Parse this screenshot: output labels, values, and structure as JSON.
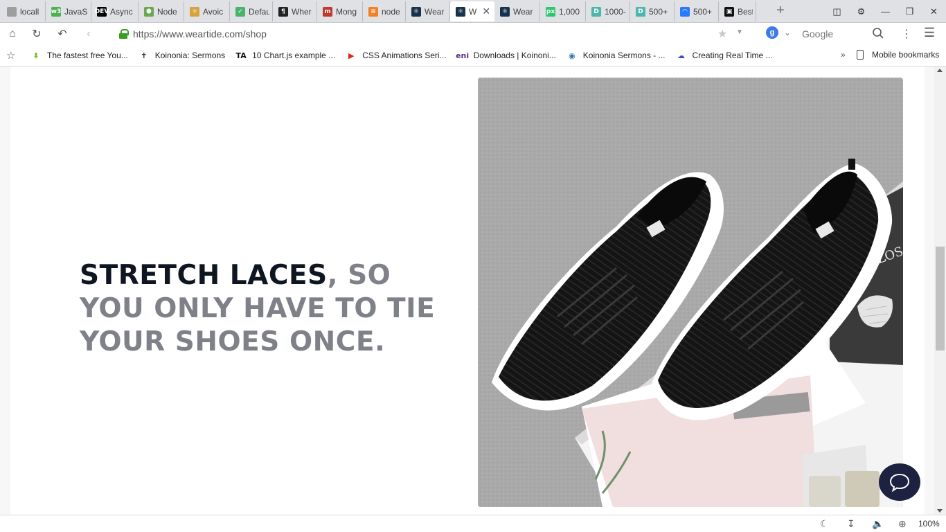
{
  "browser": {
    "tabs": [
      {
        "title": "locall",
        "icon": "page-icon",
        "color": "#9e9e9e"
      },
      {
        "title": "JavaS",
        "icon": "w3schools-icon",
        "color": "#4caf50"
      },
      {
        "title": "Async",
        "icon": "dev-icon",
        "color": "#000000"
      },
      {
        "title": "Node",
        "icon": "nodejs-icon",
        "color": "#6aa84f"
      },
      {
        "title": "Avoic",
        "icon": "sun-icon",
        "color": "#d7a23a"
      },
      {
        "title": "Defau",
        "icon": "shield-icon",
        "color": "#49b36b"
      },
      {
        "title": "Wher",
        "icon": "pilcrow-icon",
        "color": "#222222"
      },
      {
        "title": "Mong",
        "icon": "medium-icon",
        "color": "#c0392b"
      },
      {
        "title": "node",
        "icon": "stackoverflow-icon",
        "color": "#f48024"
      },
      {
        "title": "Wear",
        "icon": "react-icon",
        "color": "#17324d"
      },
      {
        "title": "W",
        "icon": "react-icon",
        "color": "#17324d",
        "active": true
      },
      {
        "title": "Wear",
        "icon": "react-icon",
        "color": "#17324d"
      },
      {
        "title": "1,000",
        "icon": "pixabay-icon",
        "color": "#2ec66d"
      },
      {
        "title": "1000-",
        "icon": "d-icon",
        "color": "#4db6ac"
      },
      {
        "title": "500+",
        "icon": "d-icon",
        "color": "#4db6ac"
      },
      {
        "title": "500+",
        "icon": "loading-icon",
        "color": "#2979ff"
      },
      {
        "title": "Best",
        "icon": "unsplash-icon",
        "color": "#111111"
      }
    ],
    "url": "https://www.weartide.com/shop",
    "search_engine_letter": "g",
    "search_placeholder": "Google",
    "zoom": "100%"
  },
  "bookmarks": {
    "items": [
      {
        "label": "The fastest free You...",
        "icon": "download-arrow-icon",
        "color": "#6cbf2a"
      },
      {
        "label": "Koinonia: Sermons",
        "icon": "cross-icon",
        "color": "#3b2a14"
      },
      {
        "label": "10 Chart.js example ...",
        "icon": "ta-icon",
        "color": "#111111"
      },
      {
        "label": "CSS Animations Seri...",
        "icon": "youtube-icon",
        "color": "#e62117"
      },
      {
        "label": "Downloads | Koinoni...",
        "icon": "eni-icon",
        "color": "#5b2c83"
      },
      {
        "label": "Koinonia Sermons - ...",
        "icon": "globe-icon",
        "color": "#2a6fb0"
      },
      {
        "label": "Creating Real Time ...",
        "icon": "cloud-icon",
        "color": "#3a4fc4"
      }
    ],
    "overflow_label": "»",
    "mobile_label": "Mobile bookmarks"
  },
  "page": {
    "headline_highlight": "STRETCH LACES",
    "headline_rest": ", SO YOU ONLY HAVE TO TIE YOUR SHOES ONCE.",
    "headline_highlight_color": "#0e1621",
    "headline_rest_color": "#7f8189",
    "product_image_alt": "Black knit sneakers with white soles on a magazine",
    "magazine_text": "FLOS",
    "chat_button_color": "#1c2240"
  }
}
